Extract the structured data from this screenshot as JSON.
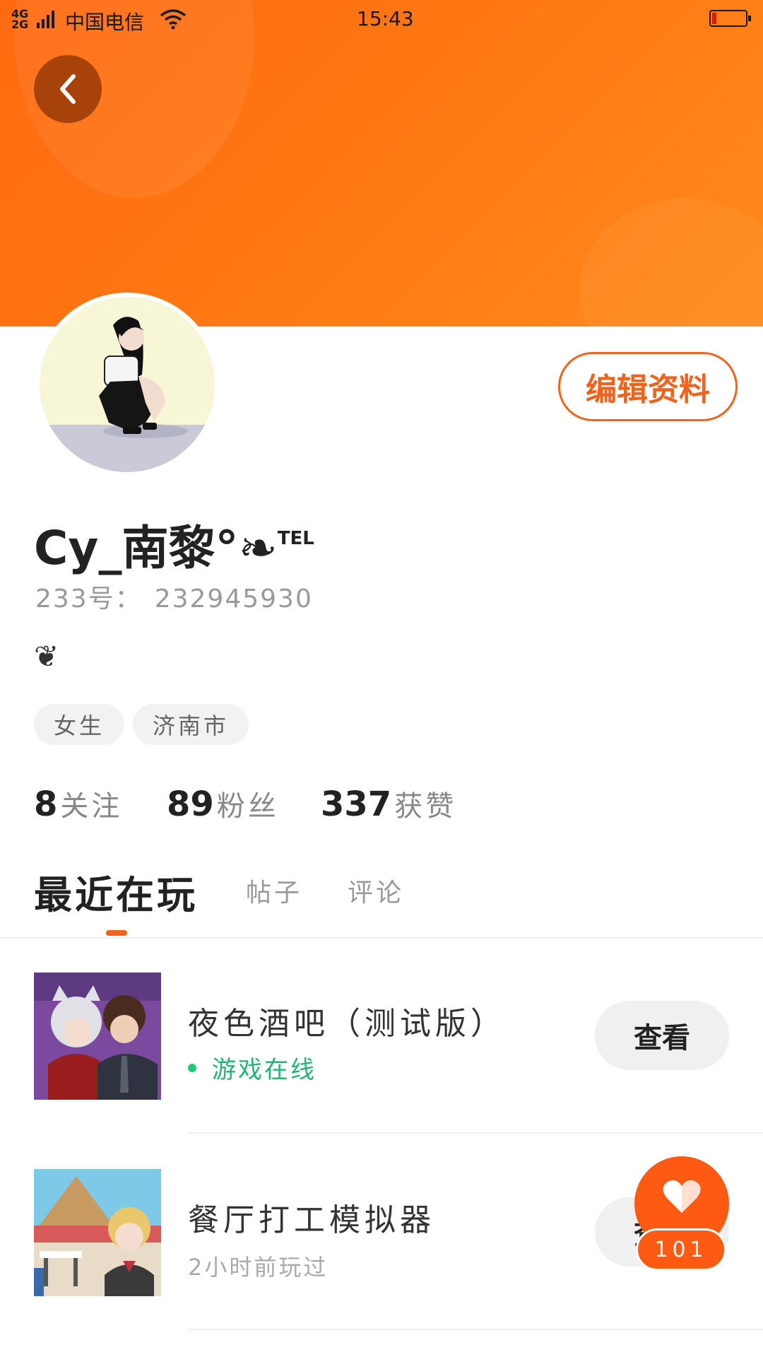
{
  "status_bar": {
    "network": "4G",
    "network2": "2G",
    "carrier": "中国电信",
    "time": "15:43"
  },
  "profile": {
    "edit_label": "编辑资料",
    "username": "Cy_南黎°❧",
    "username_suffix": "TEL",
    "uid_label": "233号：",
    "uid_value": "232945930",
    "bio": "❦",
    "tags": [
      "女生",
      "济南市"
    ]
  },
  "stats": [
    {
      "num": "8",
      "label": "关注"
    },
    {
      "num": "89",
      "label": "粉丝"
    },
    {
      "num": "337",
      "label": "获赞"
    }
  ],
  "tabs": [
    {
      "label": "最近在玩"
    },
    {
      "label": "帖子"
    },
    {
      "label": "评论"
    }
  ],
  "games": [
    {
      "title": "夜色酒吧（测试版）",
      "status": "游戏在线",
      "button": "查看"
    },
    {
      "title": "餐厅打工模拟器",
      "status": "2小时前玩过",
      "button": "查看"
    }
  ],
  "like": {
    "count": "101"
  },
  "colors": {
    "accent": "#f2621a",
    "banner": "#ff7a14",
    "online": "#22b573"
  }
}
